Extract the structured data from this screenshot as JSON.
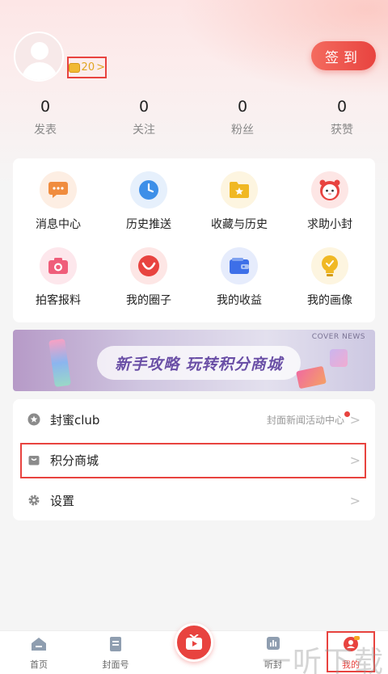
{
  "profile": {
    "coins": "20",
    "coins_chevron": ">",
    "checkin_label": "签到"
  },
  "stats": [
    {
      "value": "0",
      "label": "发表"
    },
    {
      "value": "0",
      "label": "关注"
    },
    {
      "value": "0",
      "label": "粉丝"
    },
    {
      "value": "0",
      "label": "获赞"
    }
  ],
  "grid": [
    {
      "label": "消息中心",
      "icon": "message-icon",
      "color": "#f08c3e"
    },
    {
      "label": "历史推送",
      "icon": "clock-icon",
      "color": "#3d8fe8"
    },
    {
      "label": "收藏与历史",
      "icon": "folder-star-icon",
      "color": "#f0b824"
    },
    {
      "label": "求助小封",
      "icon": "mascot-icon",
      "color": "#e8433f"
    },
    {
      "label": "拍客报料",
      "icon": "camera-icon",
      "color": "#ef5d7a"
    },
    {
      "label": "我的圈子",
      "icon": "smile-icon",
      "color": "#e8433f"
    },
    {
      "label": "我的收益",
      "icon": "wallet-icon",
      "color": "#3d6fe8"
    },
    {
      "label": "我的画像",
      "icon": "bulb-icon",
      "color": "#f0b824"
    }
  ],
  "banner": {
    "slogan": "新手攻略 玩转积分商城",
    "brand": "COVER NEWS"
  },
  "menu": [
    {
      "label": "封蜜club",
      "right_text": "封面新闻活动中心",
      "icon": "star-icon"
    },
    {
      "label": "积分商城",
      "right_text": "",
      "icon": "bag-icon"
    },
    {
      "label": "设置",
      "right_text": "",
      "icon": "gear-icon"
    }
  ],
  "chevron": ">",
  "tabs": [
    {
      "label": "首页",
      "icon": "home-icon"
    },
    {
      "label": "封面号",
      "icon": "document-icon"
    },
    {
      "label": "听封",
      "icon": "audio-icon"
    },
    {
      "label": "我的",
      "icon": "user-icon"
    }
  ],
  "watermark": "一听下载",
  "colors": {
    "accent": "#e8433f",
    "coin": "#e0a521"
  }
}
